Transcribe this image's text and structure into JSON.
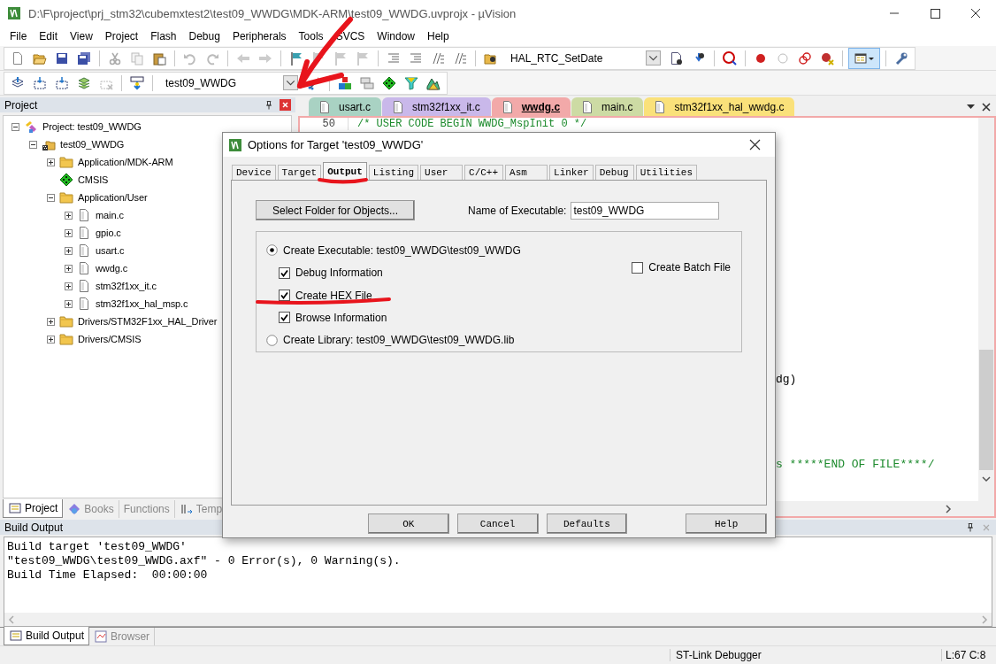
{
  "window": {
    "title": "D:\\F\\project\\prj_stm32\\cubemxtest2\\test09_WWDG\\MDK-ARM\\test09_WWDG.uvprojx - µVision"
  },
  "menu": [
    "File",
    "Edit",
    "View",
    "Project",
    "Flash",
    "Debug",
    "Peripherals",
    "Tools",
    "SVCS",
    "Window",
    "Help"
  ],
  "toolbar": {
    "function_box": "HAL_RTC_SetDate",
    "target_box": "test09_WWDG"
  },
  "project_panel": {
    "title": "Project",
    "tree": [
      {
        "kind": "project",
        "label": "Project: test09_WWDG",
        "expanded": true,
        "children": [
          {
            "kind": "target",
            "label": "test09_WWDG",
            "expanded": true,
            "children": [
              {
                "kind": "folder",
                "label": "Application/MDK-ARM",
                "expanded": false
              },
              {
                "kind": "component",
                "label": "CMSIS"
              },
              {
                "kind": "folder",
                "label": "Application/User",
                "expanded": true,
                "children": [
                  {
                    "kind": "file",
                    "label": "main.c",
                    "expanded": false
                  },
                  {
                    "kind": "file",
                    "label": "gpio.c",
                    "expanded": false
                  },
                  {
                    "kind": "file",
                    "label": "usart.c",
                    "expanded": false
                  },
                  {
                    "kind": "file",
                    "label": "wwdg.c",
                    "expanded": false
                  },
                  {
                    "kind": "file",
                    "label": "stm32f1xx_it.c",
                    "expanded": false
                  },
                  {
                    "kind": "file",
                    "label": "stm32f1xx_hal_msp.c",
                    "expanded": false
                  }
                ]
              },
              {
                "kind": "folder",
                "label": "Drivers/STM32F1xx_HAL_Driver",
                "expanded": false
              },
              {
                "kind": "folder",
                "label": "Drivers/CMSIS",
                "expanded": false
              }
            ]
          }
        ]
      }
    ],
    "tabs": [
      {
        "label": "Project",
        "selected": true
      },
      {
        "label": "Books",
        "selected": false
      },
      {
        "label": "Functions",
        "selected": false
      },
      {
        "label": "Temp",
        "selected": false
      }
    ]
  },
  "editor": {
    "tabs": [
      {
        "label": "usart.c",
        "color": "#a9d2c3",
        "selected": false
      },
      {
        "label": "stm32f1xx_it.c",
        "color": "#c9b8ea",
        "selected": false
      },
      {
        "label": "wwdg.c",
        "color": "#f2a9a9",
        "selected": true
      },
      {
        "label": "main.c",
        "color": "#cddba4",
        "selected": false
      },
      {
        "label": "stm32f1xx_hal_wwdg.c",
        "color": "#fae17a",
        "selected": false
      }
    ],
    "line_number": "50",
    "first_line": "/* USER CODE BEGIN WWDG_MspInit 0 */",
    "fragments": [
      "dg)",
      "s *****END OF FILE****/"
    ]
  },
  "dialog": {
    "title": "Options for Target 'test09_WWDG'",
    "tabs": [
      {
        "label": "Device",
        "selected": false
      },
      {
        "label": "Target",
        "selected": false
      },
      {
        "label": "Output",
        "selected": true
      },
      {
        "label": "Listing",
        "selected": false
      },
      {
        "label": "User",
        "selected": false
      },
      {
        "label": "C/C++",
        "selected": false
      },
      {
        "label": "Asm",
        "selected": false
      },
      {
        "label": "Linker",
        "selected": false
      },
      {
        "label": "Debug",
        "selected": false
      },
      {
        "label": "Utilities",
        "selected": false
      }
    ],
    "folder_button": "Select Folder for Objects...",
    "name_label": "Name of Executable:",
    "name_value": "test09_WWDG",
    "options": [
      {
        "kind": "radio",
        "label": "Create Executable:  test09_WWDG\\test09_WWDG",
        "selected": true
      },
      {
        "kind": "checkbox",
        "label": "Debug Information",
        "checked": true
      },
      {
        "kind": "checkbox",
        "label": "Create HEX File",
        "checked": true
      },
      {
        "kind": "checkbox",
        "label": "Browse Information",
        "checked": true
      },
      {
        "kind": "radio",
        "label": "Create Library:  test09_WWDG\\test09_WWDG.lib",
        "selected": false
      }
    ],
    "batch": {
      "label": "Create Batch File",
      "checked": false
    },
    "buttons": [
      "OK",
      "Cancel",
      "Defaults",
      "Help"
    ]
  },
  "build_output": {
    "title": "Build Output",
    "lines": [
      "Build target 'test09_WWDG'",
      "\"test09_WWDG\\test09_WWDG.axf\" - 0 Error(s), 0 Warning(s).",
      "Build Time Elapsed:  00:00:00"
    ]
  },
  "bottom_tabs": [
    {
      "label": "Build Output",
      "selected": true
    },
    {
      "label": "Browser",
      "selected": false
    }
  ],
  "status_bar": {
    "debugger": "ST-Link Debugger",
    "cursor": "L:67 C:8"
  }
}
